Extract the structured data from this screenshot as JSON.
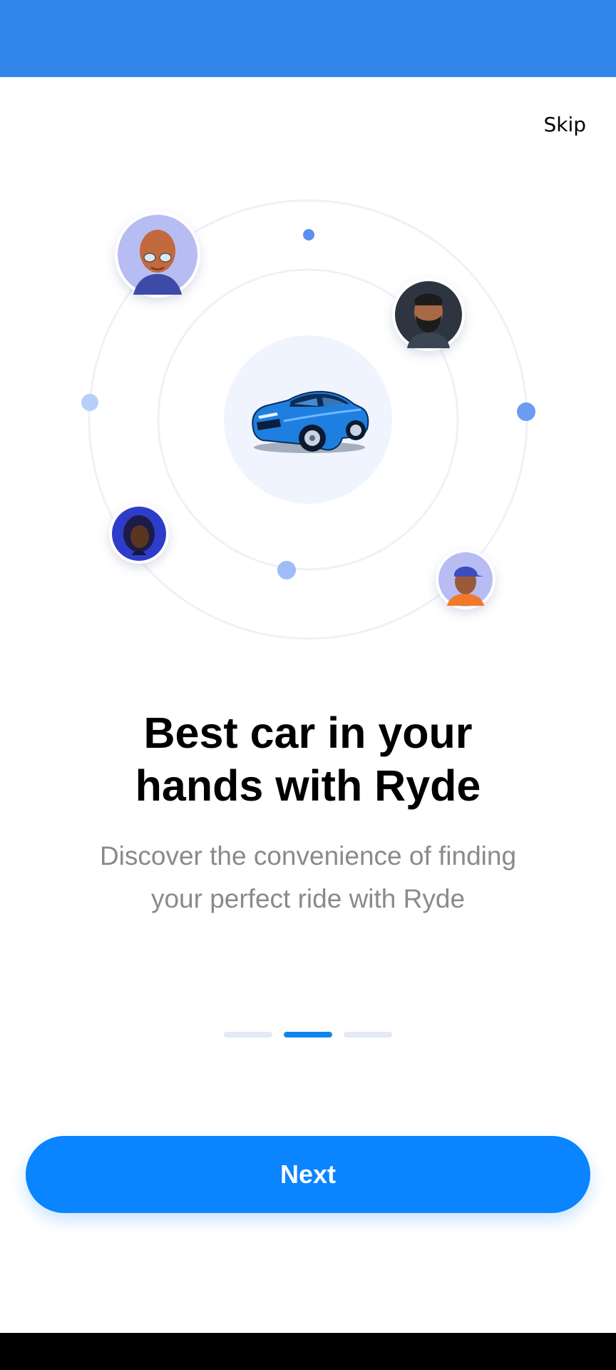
{
  "header": {
    "skip_label": "Skip"
  },
  "onboarding": {
    "title_line1": "Best car in your",
    "title_line2": "hands with Ryde",
    "subtitle_line1": "Discover the convenience of finding",
    "subtitle_line2": "your perfect ride with Ryde",
    "current_page": 2,
    "total_pages": 3
  },
  "actions": {
    "next_label": "Next"
  },
  "colors": {
    "status_bar": "#3286EA",
    "primary": "#0A84FF",
    "car_body": "#1E88E5",
    "orbit_dot": "#5B8FF0"
  },
  "icons": {
    "car": "car-icon",
    "avatars": [
      "avatar-woman-glasses",
      "avatar-man-beard",
      "avatar-woman-hijab",
      "avatar-man-cap"
    ]
  }
}
